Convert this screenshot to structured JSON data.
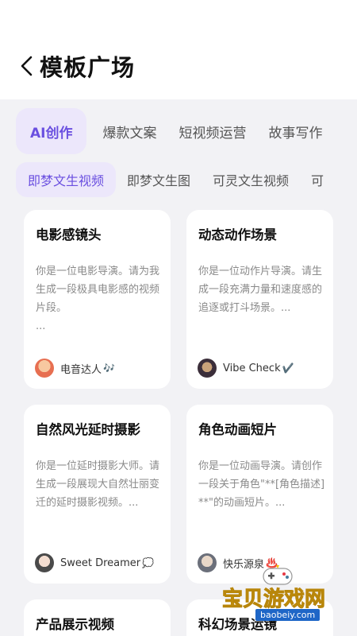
{
  "header": {
    "title": "模板广场"
  },
  "category_tabs": [
    {
      "label": "AI创作",
      "active": true
    },
    {
      "label": "爆款文案",
      "active": false
    },
    {
      "label": "短视频运营",
      "active": false
    },
    {
      "label": "故事写作",
      "active": false
    }
  ],
  "sub_tabs": [
    {
      "label": "即梦文生视频",
      "active": true
    },
    {
      "label": "即梦文生图",
      "active": false
    },
    {
      "label": "可灵文生视频",
      "active": false
    },
    {
      "label": "可",
      "active": false
    }
  ],
  "cards": [
    {
      "title": "电影感镜头",
      "desc": "你是一位电影导演。请为我生成一段极具电影感的视频片段。\n...",
      "author": "电音达人",
      "author_emoji": "🎶"
    },
    {
      "title": "动态动作场景",
      "desc": "你是一位动作片导演。请生成一段充满力量和速度感的追逐或打斗场景。...",
      "author": "Vibe Check",
      "author_emoji": "✔️"
    },
    {
      "title": "自然风光延时摄影",
      "desc": "你是一位延时摄影大师。请生成一段展现大自然壮丽变迁的延时摄影视频。...",
      "author": "Sweet Dreamer",
      "author_emoji": "💭"
    },
    {
      "title": "角色动画短片",
      "desc": "你是一位动画导演。请创作一段关于角色\"**[角色描述]**\"的动画短片。...",
      "author": "快乐源泉",
      "author_emoji": "♨️"
    },
    {
      "title": "产品展示视频",
      "desc": "",
      "author": "",
      "author_emoji": ""
    },
    {
      "title": "科幻场景运镜",
      "desc": "",
      "author": "",
      "author_emoji": ""
    }
  ],
  "watermark": {
    "text": "宝贝游戏网",
    "url": "baobeiy.com"
  },
  "colors": {
    "accent": "#6a4fe0",
    "accent_bg": "#ece7fb",
    "panel_bg": "#f2f2f5",
    "card_bg": "#ffffff"
  },
  "icons": {
    "back": "chevron-left-icon"
  }
}
